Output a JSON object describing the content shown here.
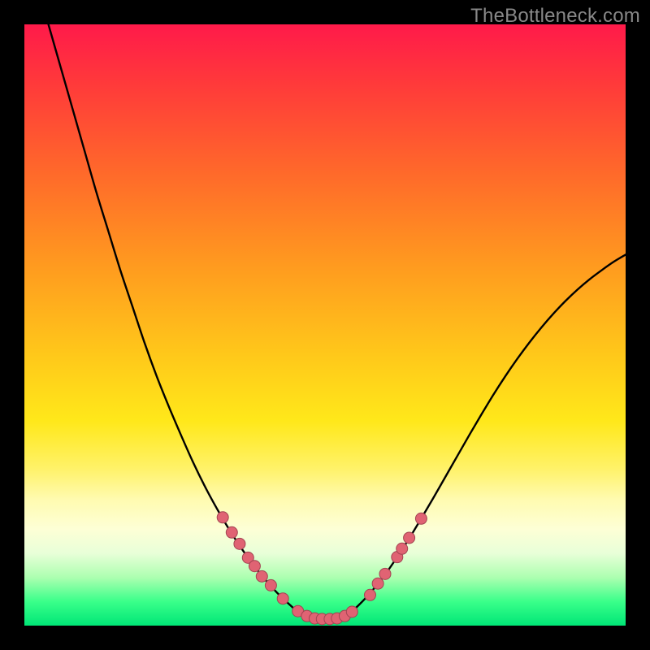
{
  "watermark": "TheBottleneck.com",
  "chart_data": {
    "type": "line",
    "title": "",
    "xlabel": "",
    "ylabel": "",
    "xlim": [
      0,
      100
    ],
    "ylim": [
      0,
      100
    ],
    "background_gradient": {
      "top": "#ff1a4a",
      "mid": "#ffe81a",
      "bottom_band": "#00e676"
    },
    "series": [
      {
        "name": "left-curve",
        "stroke": "#000000",
        "x": [
          4,
          6,
          8,
          10,
          12,
          14,
          16,
          18,
          20,
          22,
          24,
          26,
          28,
          30,
          32,
          34,
          36,
          38,
          40,
          42,
          44,
          45,
          46
        ],
        "values": [
          100,
          93,
          86,
          79,
          72,
          65.5,
          59,
          53,
          47,
          41.5,
          36.5,
          31.8,
          27.3,
          23.2,
          19.5,
          16.1,
          13.0,
          10.2,
          7.7,
          5.5,
          3.6,
          2.7,
          2.0
        ]
      },
      {
        "name": "valley-floor",
        "stroke": "#000000",
        "x": [
          46,
          48,
          50,
          52,
          54
        ],
        "values": [
          2.0,
          1.2,
          1.0,
          1.2,
          2.0
        ]
      },
      {
        "name": "right-curve",
        "stroke": "#000000",
        "x": [
          54,
          56,
          58,
          60,
          62,
          64,
          66,
          68,
          70,
          72,
          74,
          76,
          78,
          80,
          82,
          84,
          86,
          88,
          90,
          92,
          94,
          96,
          98,
          100
        ],
        "values": [
          2.0,
          3.8,
          6.0,
          8.5,
          11.4,
          14.5,
          17.8,
          21.2,
          24.7,
          28.2,
          31.7,
          35.1,
          38.4,
          41.5,
          44.4,
          47.1,
          49.6,
          51.9,
          54.0,
          55.9,
          57.6,
          59.1,
          60.5,
          61.7
        ]
      }
    ],
    "markers": {
      "name": "highlight-points",
      "fill": "#e06373",
      "stroke": "#a34452",
      "radius_px": 7,
      "points": [
        {
          "x": 33.0,
          "y": 18.0
        },
        {
          "x": 34.5,
          "y": 15.5
        },
        {
          "x": 35.8,
          "y": 13.6
        },
        {
          "x": 37.2,
          "y": 11.3
        },
        {
          "x": 38.3,
          "y": 9.9
        },
        {
          "x": 39.5,
          "y": 8.2
        },
        {
          "x": 41.0,
          "y": 6.7
        },
        {
          "x": 43.0,
          "y": 4.5
        },
        {
          "x": 45.5,
          "y": 2.4
        },
        {
          "x": 47.0,
          "y": 1.6
        },
        {
          "x": 48.3,
          "y": 1.2
        },
        {
          "x": 49.5,
          "y": 1.1
        },
        {
          "x": 50.8,
          "y": 1.1
        },
        {
          "x": 52.0,
          "y": 1.2
        },
        {
          "x": 53.3,
          "y": 1.6
        },
        {
          "x": 54.5,
          "y": 2.3
        },
        {
          "x": 57.5,
          "y": 5.1
        },
        {
          "x": 58.8,
          "y": 7.0
        },
        {
          "x": 60.0,
          "y": 8.6
        },
        {
          "x": 62.0,
          "y": 11.4
        },
        {
          "x": 62.8,
          "y": 12.8
        },
        {
          "x": 64.0,
          "y": 14.6
        },
        {
          "x": 66.0,
          "y": 17.8
        }
      ]
    }
  }
}
